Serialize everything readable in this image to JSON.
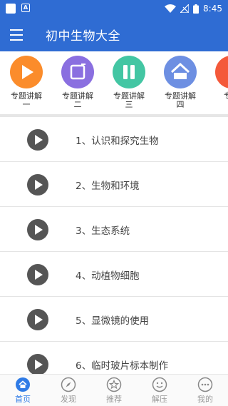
{
  "status_bar": {
    "time": "8:45"
  },
  "app_bar": {
    "title": "初中生物大全"
  },
  "topics": [
    {
      "label": "专题讲解",
      "sub": "一",
      "color": "#fb8c2b",
      "icon": "play-icon"
    },
    {
      "label": "专题讲解",
      "sub": "二",
      "color": "#8a6fe0",
      "icon": "square-icon"
    },
    {
      "label": "专题讲解",
      "sub": "三",
      "color": "#43c6a3",
      "icon": "pause-icon"
    },
    {
      "label": "专题讲解",
      "sub": "四",
      "color": "#6d8fe2",
      "icon": "home-icon"
    },
    {
      "label": "专题",
      "sub": "",
      "color": "#f4593a",
      "icon": "partial-icon"
    }
  ],
  "lessons": [
    "1、认识和探究生物",
    "2、生物和环境",
    "3、生态系统",
    "4、动植物细胞",
    "5、显微镜的使用",
    "6、临时玻片标本制作"
  ],
  "bottom_nav": [
    {
      "label": "首页",
      "icon": "home-icon",
      "active": true
    },
    {
      "label": "发现",
      "icon": "compass-icon",
      "active": false
    },
    {
      "label": "推荐",
      "icon": "star-icon",
      "active": false
    },
    {
      "label": "解压",
      "icon": "face-icon",
      "active": false
    },
    {
      "label": "我的",
      "icon": "chat-icon",
      "active": false
    }
  ],
  "colors": {
    "primary": "#2f6cd3",
    "active_nav": "#2f7be6"
  }
}
